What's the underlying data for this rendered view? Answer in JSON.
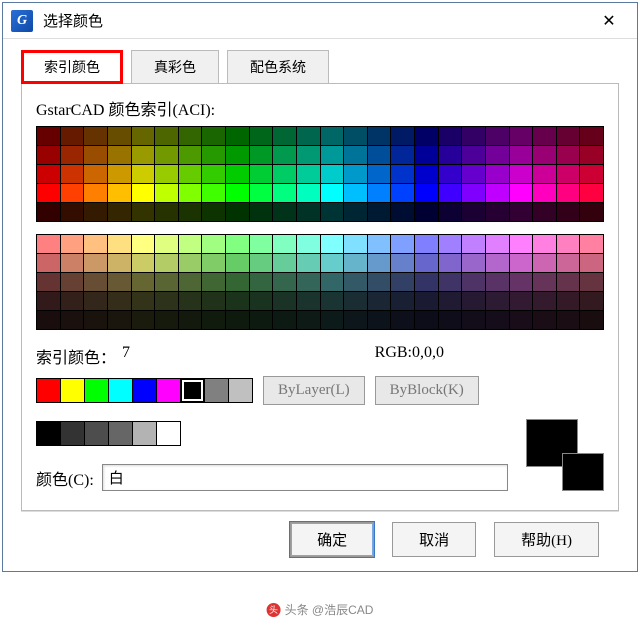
{
  "window": {
    "title": "选择颜色",
    "app_icon_letter": "G"
  },
  "tabs": [
    {
      "label": "索引颜色",
      "active": true
    },
    {
      "label": "真彩色",
      "active": false
    },
    {
      "label": "配色系统",
      "active": false
    }
  ],
  "aci_section_label": "GstarCAD 颜色索引(ACI):",
  "main_grid": {
    "rows": 5,
    "cols": 24,
    "row_colors": [
      [
        "#660000",
        "#661a00",
        "#663300",
        "#664d00",
        "#666600",
        "#4d6600",
        "#336600",
        "#1a6600",
        "#006600",
        "#00661a",
        "#006633",
        "#00664d",
        "#006666",
        "#004d66",
        "#003366",
        "#001a66",
        "#000066",
        "#1a0066",
        "#330066",
        "#4d0066",
        "#660066",
        "#66004d",
        "#660033",
        "#66001a"
      ],
      [
        "#990000",
        "#992600",
        "#994d00",
        "#997300",
        "#999900",
        "#739900",
        "#4d9900",
        "#269900",
        "#009900",
        "#009926",
        "#00994d",
        "#009973",
        "#009999",
        "#007399",
        "#004d99",
        "#002699",
        "#000099",
        "#260099",
        "#4d0099",
        "#730099",
        "#990099",
        "#990073",
        "#99004d",
        "#990026"
      ],
      [
        "#cc0000",
        "#cc3300",
        "#cc6600",
        "#cc9900",
        "#cccc00",
        "#99cc00",
        "#66cc00",
        "#33cc00",
        "#00cc00",
        "#00cc33",
        "#00cc66",
        "#00cc99",
        "#00cccc",
        "#0099cc",
        "#0066cc",
        "#0033cc",
        "#0000cc",
        "#3300cc",
        "#6600cc",
        "#9900cc",
        "#cc00cc",
        "#cc0099",
        "#cc0066",
        "#cc0033"
      ],
      [
        "#ff0000",
        "#ff4000",
        "#ff8000",
        "#ffbf00",
        "#ffff00",
        "#bfff00",
        "#80ff00",
        "#40ff00",
        "#00ff00",
        "#00ff40",
        "#00ff80",
        "#00ffbf",
        "#00ffff",
        "#00bfff",
        "#0080ff",
        "#0040ff",
        "#0000ff",
        "#4000ff",
        "#8000ff",
        "#bf00ff",
        "#ff00ff",
        "#ff00bf",
        "#ff0080",
        "#ff0040"
      ],
      [
        "#330000",
        "#330d00",
        "#331a00",
        "#332600",
        "#333300",
        "#263300",
        "#1a3300",
        "#0d3300",
        "#003300",
        "#00330d",
        "#00331a",
        "#003326",
        "#003333",
        "#002633",
        "#001a33",
        "#000d33",
        "#000033",
        "#0d0033",
        "#1a0033",
        "#260033",
        "#330033",
        "#330026",
        "#33001a",
        "#33000d"
      ]
    ]
  },
  "pastel_grid": {
    "rows": 5,
    "cols": 24,
    "row_colors": [
      [
        "#ff8080",
        "#ffa080",
        "#ffc080",
        "#ffe080",
        "#ffff80",
        "#e0ff80",
        "#c0ff80",
        "#a0ff80",
        "#80ff80",
        "#80ffa0",
        "#80ffc0",
        "#80ffe0",
        "#80ffff",
        "#80e0ff",
        "#80c0ff",
        "#80a0ff",
        "#8080ff",
        "#a080ff",
        "#c080ff",
        "#e080ff",
        "#ff80ff",
        "#ff80e0",
        "#ff80c0",
        "#ff80a0"
      ],
      [
        "#cc6666",
        "#cc8066",
        "#cc9966",
        "#ccb366",
        "#cccc66",
        "#b3cc66",
        "#99cc66",
        "#80cc66",
        "#66cc66",
        "#66cc80",
        "#66cc99",
        "#66ccb3",
        "#66cccc",
        "#66b3cc",
        "#6699cc",
        "#6680cc",
        "#6666cc",
        "#8066cc",
        "#9966cc",
        "#b366cc",
        "#cc66cc",
        "#cc66b3",
        "#cc6699",
        "#cc6680"
      ],
      [
        "#663333",
        "#664033",
        "#664d33",
        "#665933",
        "#666633",
        "#596633",
        "#4d6633",
        "#406633",
        "#336633",
        "#336640",
        "#33664d",
        "#336659",
        "#336666",
        "#335966",
        "#334d66",
        "#334066",
        "#333366",
        "#403366",
        "#4d3366",
        "#593366",
        "#663366",
        "#663359",
        "#66334d",
        "#663340"
      ],
      [
        "#331a1a",
        "#33201a",
        "#33261a",
        "#332d1a",
        "#33331a",
        "#2d331a",
        "#26331a",
        "#20331a",
        "#1a331a",
        "#1a3320",
        "#1a3326",
        "#1a332d",
        "#1a3333",
        "#1a2d33",
        "#1a2633",
        "#1a2033",
        "#1a1a33",
        "#201a33",
        "#261a33",
        "#2d1a33",
        "#331a33",
        "#331a2d",
        "#331a26",
        "#331a20"
      ],
      [
        "#1a0d0d",
        "#1a100d",
        "#1a130d",
        "#1a160d",
        "#1a1a0d",
        "#161a0d",
        "#131a0d",
        "#101a0d",
        "#0d1a0d",
        "#0d1a10",
        "#0d1a13",
        "#0d1a16",
        "#0d1a1a",
        "#0d161a",
        "#0d131a",
        "#0d101a",
        "#0d0d1a",
        "#100d1a",
        "#130d1a",
        "#160d1a",
        "#1a0d1a",
        "#1a0d16",
        "#1a0d13",
        "#1a0d10"
      ]
    ]
  },
  "readout": {
    "index_label": "索引颜色：",
    "index_value": "7",
    "rgb_label": "RGB:",
    "rgb_value": "0,0,0"
  },
  "standard_colors": [
    "#ff0000",
    "#ffff00",
    "#00ff00",
    "#00ffff",
    "#0000ff",
    "#ff00ff",
    "#000000",
    "#808080",
    "#c0c0c0"
  ],
  "standard_selected_index": 6,
  "bylayer_label": "ByLayer(L)",
  "byblock_label": "ByBlock(K)",
  "gray_row": [
    "#000000",
    "#333333",
    "#4d4d4d",
    "#666666",
    "#b3b3b3",
    "#ffffff"
  ],
  "color_field": {
    "label": "颜色(C):",
    "value": "白"
  },
  "preview": {
    "new_color": "#000000",
    "old_color": "#000000"
  },
  "buttons": {
    "ok": "确定",
    "cancel": "取消",
    "help": "帮助(H)"
  },
  "watermark": "头条 @浩辰CAD"
}
